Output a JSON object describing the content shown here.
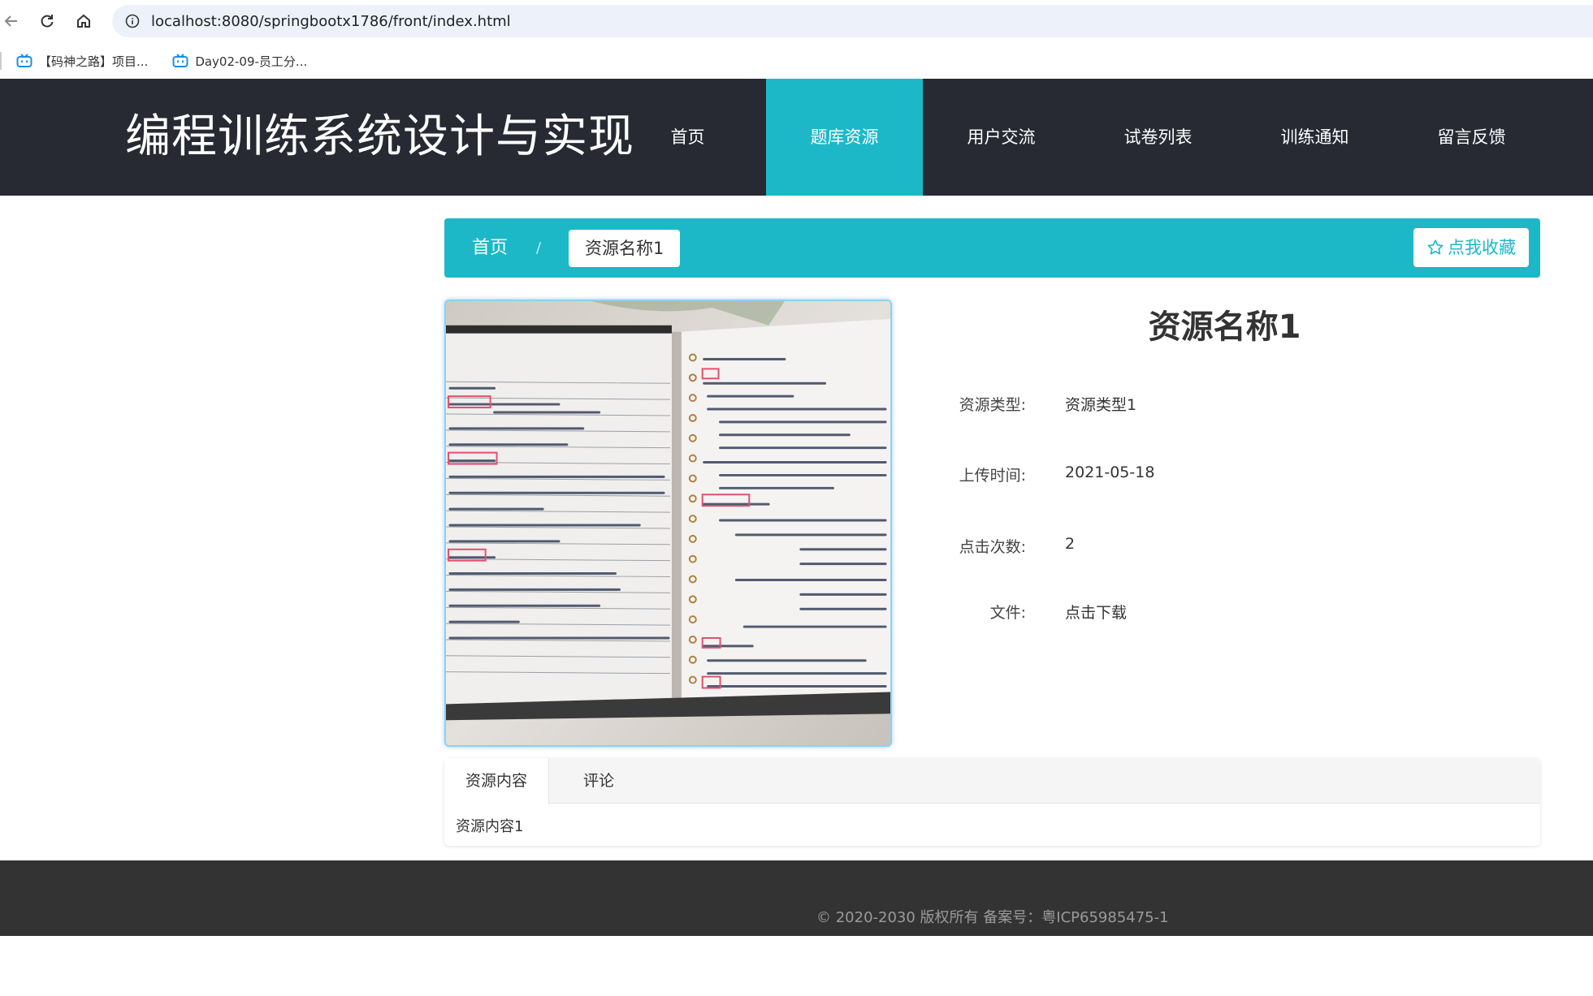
{
  "browser": {
    "url": "localhost:8080/springbootx1786/front/index.html",
    "bookmarks": [
      {
        "label": "【码神之路】项目..."
      },
      {
        "label": "Day02-09-员工分..."
      }
    ]
  },
  "header": {
    "title": "编程训练系统设计与实现",
    "nav": [
      {
        "label": "首页"
      },
      {
        "label": "题库资源"
      },
      {
        "label": "用户交流"
      },
      {
        "label": "试卷列表"
      },
      {
        "label": "训练通知"
      },
      {
        "label": "留言反馈"
      }
    ]
  },
  "breadcrumb": {
    "home": "首页",
    "separator": "/",
    "current": "资源名称1",
    "favorite": "点我收藏"
  },
  "detail": {
    "title": "资源名称1",
    "fields": [
      {
        "label": "资源类型:",
        "value": "资源类型1"
      },
      {
        "label": "上传时间:",
        "value": "2021-05-18"
      },
      {
        "label": "点击次数:",
        "value": "2"
      },
      {
        "label": "文件:",
        "value": "点击下载"
      }
    ]
  },
  "tabs": {
    "items": [
      {
        "label": "资源内容"
      },
      {
        "label": "评论"
      }
    ],
    "content": "资源内容1"
  },
  "footer": {
    "text": "© 2020-2030 版权所有 备案号：粤ICP65985475-1"
  },
  "colors": {
    "header_bg": "#272a33",
    "accent": "#1cb8c8",
    "footer_bg": "#333333"
  }
}
